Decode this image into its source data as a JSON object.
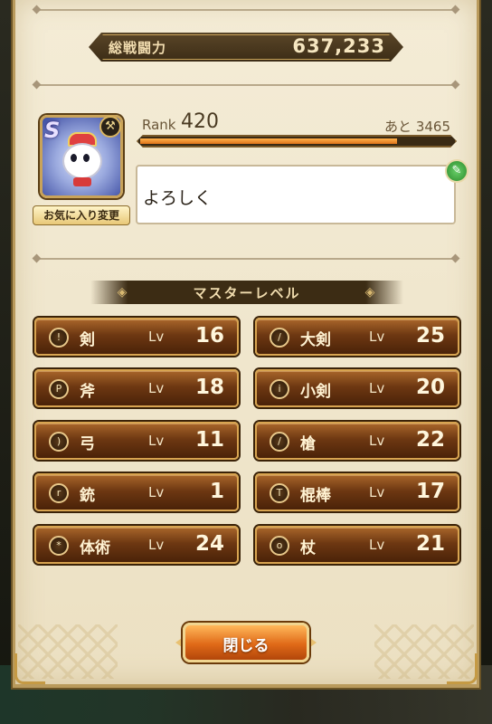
{
  "combat_power": {
    "label": "総戦闘力",
    "value": "637,233"
  },
  "profile": {
    "rank_label": "Rank",
    "rank_value": "420",
    "remaining_text": "あと 3465",
    "rank_progress": 0.82,
    "avatar_letter": "S",
    "favorite_button_label": "お気に入り変更",
    "comment": "よろしく"
  },
  "master_level": {
    "title": "マスターレベル",
    "weapons": [
      {
        "name": "剣",
        "lv_label": "Lv",
        "level": "16",
        "icon": "sword-icon",
        "glyph": "!"
      },
      {
        "name": "大剣",
        "lv_label": "Lv",
        "level": "25",
        "icon": "greatsword-icon",
        "glyph": "/"
      },
      {
        "name": "斧",
        "lv_label": "Lv",
        "level": "18",
        "icon": "axe-icon",
        "glyph": "P"
      },
      {
        "name": "小剣",
        "lv_label": "Lv",
        "level": "20",
        "icon": "dagger-icon",
        "glyph": "i"
      },
      {
        "name": "弓",
        "lv_label": "Lv",
        "level": "11",
        "icon": "bow-icon",
        "glyph": ")"
      },
      {
        "name": "槍",
        "lv_label": "Lv",
        "level": "22",
        "icon": "spear-icon",
        "glyph": "/"
      },
      {
        "name": "銃",
        "lv_label": "Lv",
        "level": "1",
        "icon": "gun-icon",
        "glyph": "r"
      },
      {
        "name": "棍棒",
        "lv_label": "Lv",
        "level": "17",
        "icon": "club-icon",
        "glyph": "T"
      },
      {
        "name": "体術",
        "lv_label": "Lv",
        "level": "24",
        "icon": "fist-icon",
        "glyph": "*"
      },
      {
        "name": "杖",
        "lv_label": "Lv",
        "level": "21",
        "icon": "staff-icon",
        "glyph": "o"
      }
    ]
  },
  "close_button": {
    "label": "閉じる"
  },
  "colors": {
    "accent": "#e06a18",
    "panel": "#f4ecd6",
    "weapon_button": "#6e3812"
  }
}
